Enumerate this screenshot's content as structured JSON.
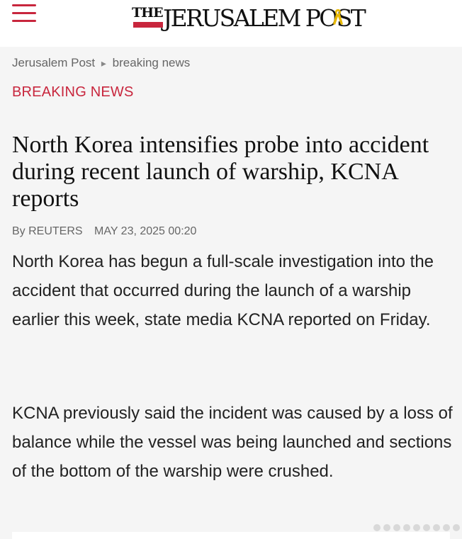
{
  "header": {
    "menu_icon": "hamburger-menu-icon",
    "logo": {
      "the": "THE",
      "name": "JERUSALEM POST",
      "ribbon_icon": "yellow-ribbon-icon",
      "accent_color": "#c8263d",
      "ribbon_color": "#e8b800"
    }
  },
  "breadcrumb": {
    "home": "Jerusalem Post",
    "separator_icon": "chevron-right-icon",
    "section": "breaking news"
  },
  "article": {
    "category": "BREAKING NEWS",
    "headline": "North Korea intensifies probe into accident during recent launch of warship, KCNA reports",
    "byline": "By REUTERS",
    "date": "MAY 23, 2025 00:20",
    "paragraphs": [
      "North Korea has begun a full-scale investigation into the accident that occurred during the launch of a warship earlier this week, state media KCNA reported on Friday.",
      "KCNA previously said the incident was caused by a loss of balance while the vessel was being launched and sections of the bottom of the warship were crushed."
    ]
  },
  "colors": {
    "background": "#f5f5f5",
    "header_bg": "#ffffff",
    "brand_red": "#c8263d",
    "text": "#222222",
    "muted_text": "#666666"
  }
}
